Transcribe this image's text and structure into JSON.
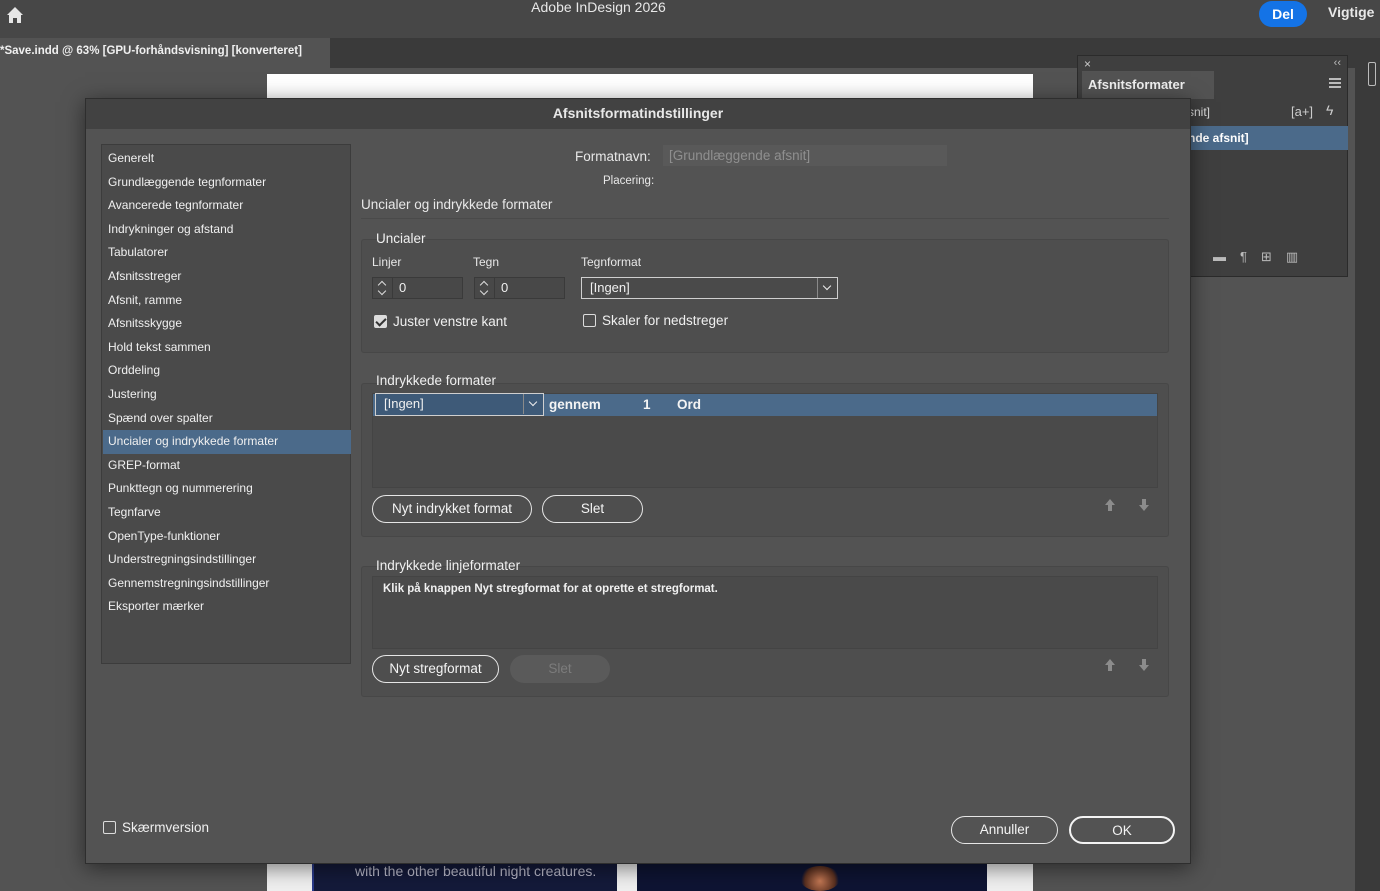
{
  "app": {
    "title": "Adobe InDesign 2026",
    "share_label": "Del",
    "important_label": "Vigtige",
    "share_color": "#1473e6"
  },
  "document": {
    "tab_label": "*Save.indd @ 63% [GPU-forhåndsvisning] [konverteret]",
    "page_text": "with the other beautiful night creatures."
  },
  "panel": {
    "close_glyph": "×",
    "collapse_glyph": "‹‹",
    "tab_label": "Afsnitsformater",
    "row1": "snit]",
    "row1_icon": "[a+]",
    "row2": "nde afsnit]",
    "footer_icons": [
      "folder-icon",
      "paragraph-clear-icon",
      "new-style-icon",
      "trash-icon"
    ]
  },
  "dialog": {
    "title": "Afsnitsformatindstillinger",
    "sidebar": [
      "Generelt",
      "Grundlæggende tegnformater",
      "Avancerede tegnformater",
      "Indrykninger og afstand",
      "Tabulatorer",
      "Afsnitsstreger",
      "Afsnit, ramme",
      "Afsnitsskygge",
      "Hold tekst sammen",
      "Orddeling",
      "Justering",
      "Spænd over spalter",
      "Uncialer og indrykkede formater",
      "GREP-format",
      "Punkttegn og nummerering",
      "Tegnfarve",
      "OpenType-funktioner",
      "Understregningsindstillinger",
      "Gennemstregningsindstillinger",
      "Eksporter mærker"
    ],
    "selected_sidebar_index": 12,
    "formatnavn_label": "Formatnavn:",
    "formatnavn_value": "[Grundlæggende afsnit]",
    "placering_label": "Placering:",
    "section_title": "Uncialer og indrykkede formater",
    "dropcaps": {
      "title": "Uncialer",
      "lines_label": "Linjer",
      "lines_value": "0",
      "chars_label": "Tegn",
      "chars_value": "0",
      "charstyle_label": "Tegnformat",
      "charstyle_value": "[Ingen]",
      "align_left_label": "Juster venstre kant",
      "align_left_checked": true,
      "scale_label": "Skaler for nedstreger",
      "scale_checked": false
    },
    "nested": {
      "title": "Indrykkede formater",
      "row_style": "[Ingen]",
      "row_through": "gennem",
      "row_count": "1",
      "row_unit": "Ord",
      "new_button": "Nyt indrykket format",
      "delete_button": "Slet"
    },
    "nested_line": {
      "title": "Indrykkede linjeformater",
      "hint": "Klik på knappen Nyt stregformat for at oprette et stregformat.",
      "new_button": "Nyt stregformat",
      "delete_button": "Slet"
    },
    "preview_label": "Skærmversion",
    "preview_checked": false,
    "cancel_button": "Annuller",
    "ok_button": "OK"
  }
}
